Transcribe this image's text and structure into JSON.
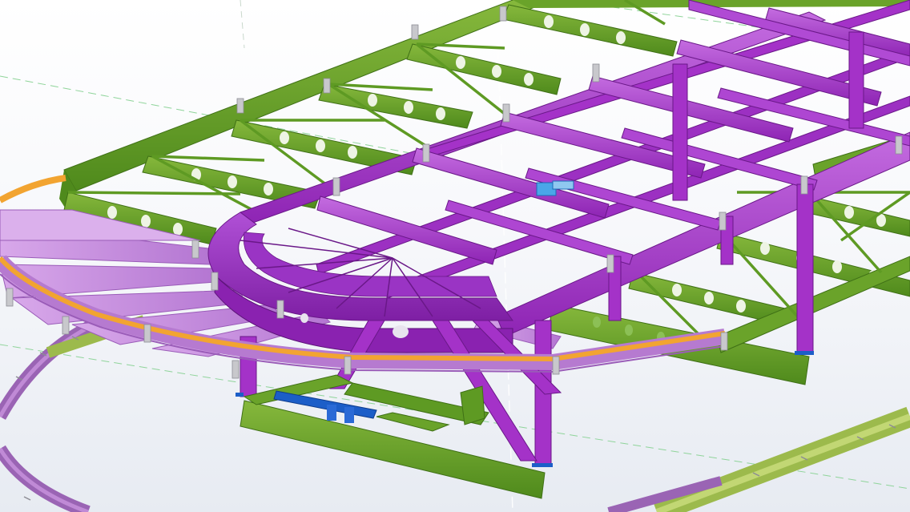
{
  "viewport": {
    "background_top": "#ffffff",
    "background_bottom": "#e7ebf2"
  },
  "model": {
    "view": "3d-perspective",
    "colors": {
      "primary_steel_purple": "#a432c8",
      "purple_dark": "#7a1f9a",
      "purple_light": "#c46ce0",
      "pale_purple_rafters": "#c98fdf",
      "secondary_steel_green": "#5e9a23",
      "green_dark": "#3f7016",
      "green_light": "#86b83c",
      "edge_beam_orange": "#f2a431",
      "plates_grey": "#c8c8cc",
      "base_plates_blue": "#1c5ec8",
      "selected_part_blue": "#4aa6e8",
      "lower_ring_purple": "#9a64b4",
      "lower_ring_olive": "#9cba4c",
      "gridline_green_dash": "#8fd49a",
      "gridline_white": "#ffffff"
    },
    "layers": [
      "outer-green-frame",
      "green-perforated-girders",
      "green-diagonal-bracing",
      "purple-longitudinal-beams",
      "purple-cross-beams",
      "purple-curved-end-ring",
      "radial-rafters",
      "orange-edge-beam",
      "purple-support-columns",
      "green-foundation-frame",
      "blue-connection-parts",
      "lower-ring-beams"
    ]
  }
}
